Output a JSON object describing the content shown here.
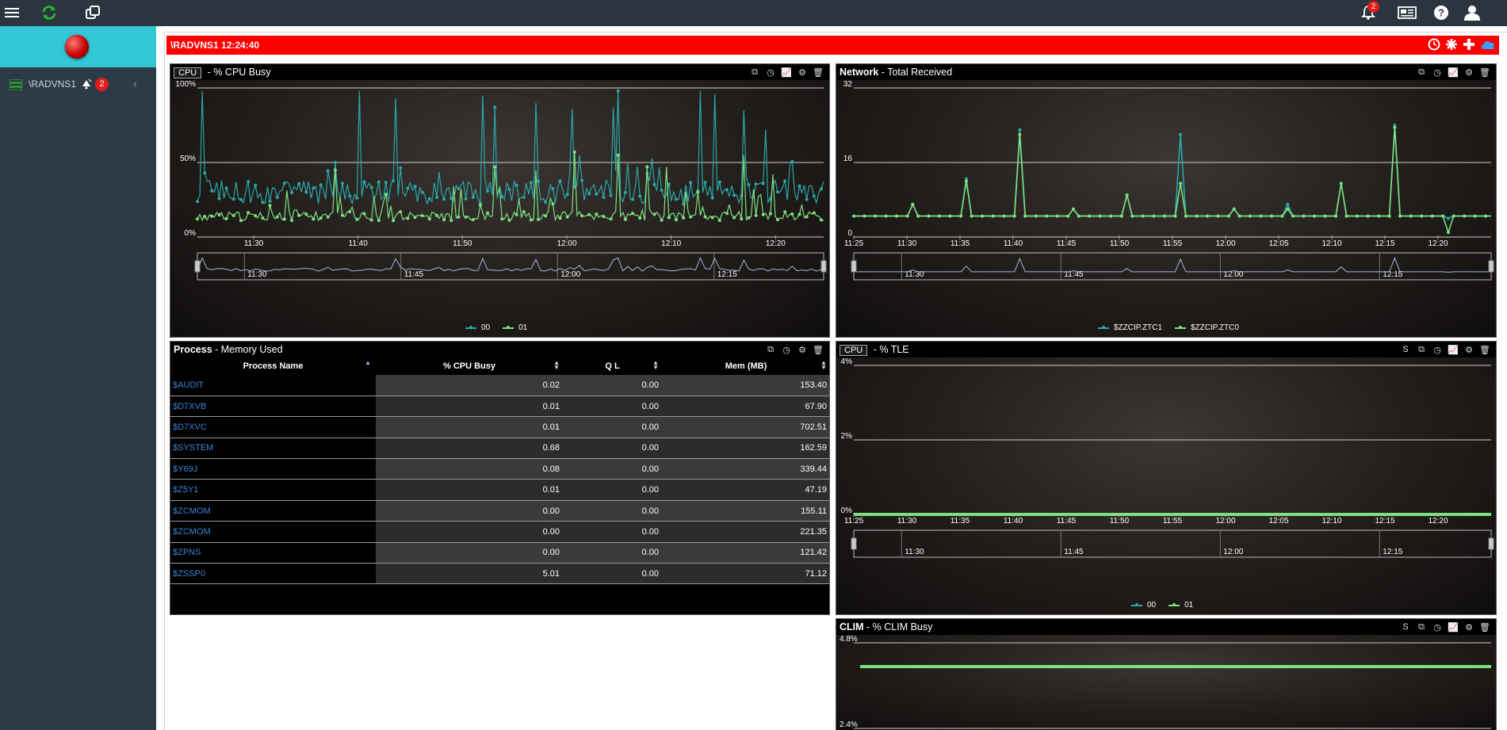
{
  "topbar": {
    "menu_icon": "hamburger-menu-icon",
    "refresh_icon": "refresh-icon",
    "windows_icon": "copy-windows-icon",
    "notifications_badge": "2",
    "icons": [
      "bell-icon",
      "news-icon",
      "help-icon",
      "user-icon"
    ]
  },
  "sidebar": {
    "node_label": "\\RADVNS1",
    "alert_badge": "2"
  },
  "system_bar": {
    "title": "\\RADVNS1 12:24:40",
    "color": "#ff0000"
  },
  "panels": {
    "cpu": {
      "tag": "CPU",
      "title": " - % CPU Busy",
      "series_colors": {
        "00": "#2aa7a7",
        "01": "#7ee07e"
      },
      "chart_data": {
        "type": "line",
        "y_ticks": [
          "100%",
          "50%",
          "0%"
        ],
        "ylim": [
          0,
          100
        ],
        "x_ticks": [
          "11:30",
          "11:40",
          "11:50",
          "12:00",
          "12:10",
          "12:20"
        ],
        "navigator_ticks": [
          "11:30",
          "11:45",
          "12:00",
          "12:15"
        ],
        "series": [
          {
            "name": "00",
            "baseline": 30,
            "noise": 8,
            "spikes": [
              [
                2,
                98
              ],
              [
                57,
                50
              ],
              [
                67,
                98
              ],
              [
                82,
                93
              ],
              [
                118,
                95
              ],
              [
                123,
                87
              ],
              [
                140,
                90
              ],
              [
                155,
                86
              ],
              [
                172,
                87
              ],
              [
                174,
                98
              ],
              [
                208,
                98
              ],
              [
                214,
                96
              ],
              [
                226,
                85
              ],
              [
                235,
                72
              ]
            ]
          },
          {
            "name": "01",
            "baseline": 14,
            "noise": 3,
            "spikes": [
              [
                57,
                45
              ],
              [
                123,
                47
              ],
              [
                140,
                45
              ],
              [
                156,
                57
              ],
              [
                174,
                55
              ],
              [
                186,
                47
              ],
              [
                194,
                47
              ],
              [
                226,
                55
              ],
              [
                238,
                42
              ]
            ]
          }
        ]
      },
      "legend": [
        "00",
        "01"
      ]
    },
    "network": {
      "title_bold": "Network",
      "title": " - Total Received",
      "chart_data": {
        "type": "line",
        "y_ticks": [
          "32",
          "16",
          "0"
        ],
        "ylim": [
          0,
          32
        ],
        "x_ticks": [
          "11:25",
          "11:30",
          "11:35",
          "11:40",
          "11:45",
          "11:50",
          "11:55",
          "12:00",
          "12:05",
          "12:10",
          "12:15",
          "12:20"
        ],
        "navigator_ticks": [
          "11:30",
          "11:45",
          "12:00",
          "12:15"
        ],
        "series": [
          {
            "name": "$ZZCIP.ZTC1",
            "baseline": 4.5,
            "spikes": [
              [
                11,
                7
              ],
              [
                21,
                12.5
              ],
              [
                31,
                23
              ],
              [
                41,
                6
              ],
              [
                51,
                9
              ],
              [
                61,
                22
              ],
              [
                71,
                6
              ],
              [
                81,
                7
              ],
              [
                91,
                11.5
              ],
              [
                101,
                24
              ],
              [
                111,
                4
              ]
            ]
          },
          {
            "name": "$ZZCIP.ZTC0",
            "baseline": 4.5,
            "spikes": [
              [
                11,
                7
              ],
              [
                21,
                12
              ],
              [
                31,
                22
              ],
              [
                41,
                6
              ],
              [
                51,
                9
              ],
              [
                61,
                11.5
              ],
              [
                71,
                6
              ],
              [
                81,
                6
              ],
              [
                91,
                11.5
              ],
              [
                101,
                23.5
              ],
              [
                111,
                1
              ]
            ]
          }
        ]
      },
      "legend": [
        "$ZZCIP.ZTC1",
        "$ZZCIP.ZTC0"
      ]
    },
    "process": {
      "title_bold": "Process",
      "title": " - Memory Used",
      "columns": [
        "Process Name",
        "% CPU Busy",
        "Q L",
        "Mem (MB)"
      ],
      "rows": [
        [
          "$AUDIT",
          "0.02",
          "0.00",
          "153.40"
        ],
        [
          "$D7XVB",
          "0.01",
          "0.00",
          "67.90"
        ],
        [
          "$D7XVC",
          "0.01",
          "0.00",
          "702.51"
        ],
        [
          "$SYSTEM",
          "0.68",
          "0.00",
          "162.59"
        ],
        [
          "$Y69J",
          "0.08",
          "0.00",
          "339.44"
        ],
        [
          "$Z5Y1",
          "0.01",
          "0.00",
          "47.19"
        ],
        [
          "$ZCMOM",
          "0.00",
          "0.00",
          "155.11"
        ],
        [
          "$ZCMOM",
          "0.00",
          "0.00",
          "221.35"
        ],
        [
          "$ZPNS",
          "0.00",
          "0.00",
          "121.42"
        ],
        [
          "$ZSSP0",
          "5.01",
          "0.00",
          "71.12"
        ]
      ]
    },
    "tle": {
      "tag": "CPU",
      "title": " - % TLE",
      "s_label": "S",
      "chart_data": {
        "type": "line",
        "y_ticks": [
          "4%",
          "2%",
          "0%"
        ],
        "ylim": [
          0,
          4
        ],
        "x_ticks": [
          "11:25",
          "11:30",
          "11:35",
          "11:40",
          "11:45",
          "11:50",
          "11:55",
          "12:00",
          "12:05",
          "12:10",
          "12:15",
          "12:20"
        ],
        "navigator_ticks": [
          "11:30",
          "11:45",
          "12:00",
          "12:15"
        ],
        "series": [
          {
            "name": "00",
            "value": 0
          },
          {
            "name": "01",
            "value": 0
          }
        ]
      },
      "legend": [
        "00",
        "01"
      ]
    },
    "clim": {
      "title_bold": "CLIM",
      "title": " - % CLIM Busy",
      "s_label": "S",
      "chart_data": {
        "type": "line",
        "y_ticks": [
          "4.8%",
          "2.4%"
        ],
        "ylim": [
          0,
          4.8
        ],
        "series": [
          {
            "name": "01",
            "value": 3.6
          }
        ]
      }
    }
  }
}
